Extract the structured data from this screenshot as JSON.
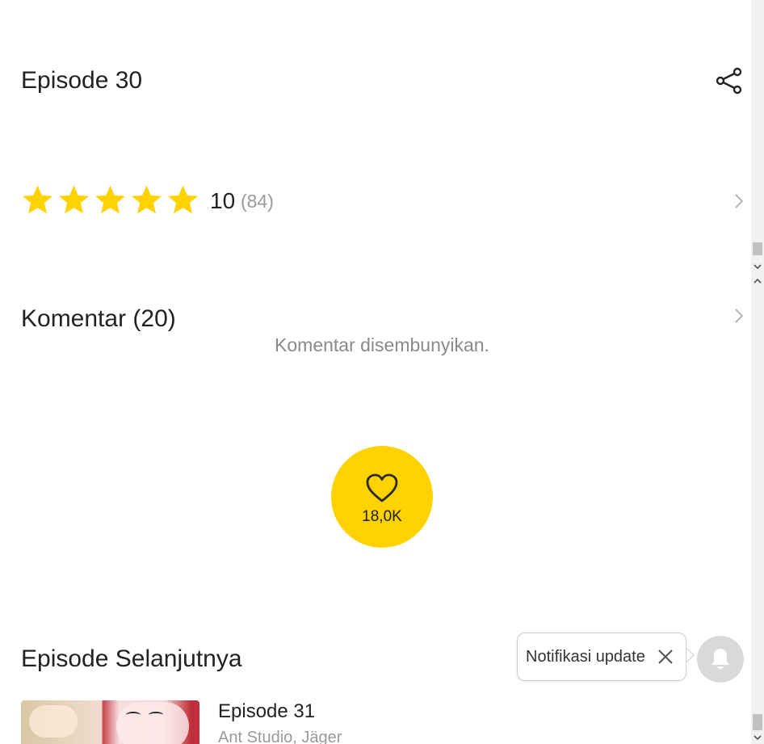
{
  "episode": {
    "title": "Episode 30"
  },
  "rating": {
    "score": "10",
    "count": "(84)",
    "stars": 5
  },
  "comments": {
    "title": "Komentar (20)",
    "hidden_text": "Komentar disembunyikan."
  },
  "like": {
    "count": "18,0K"
  },
  "next": {
    "title": "Episode Selanjutnya",
    "episode": "Episode 31",
    "author": "Ant Studio, Jäger"
  },
  "notification": {
    "text": "Notifikasi update"
  },
  "colors": {
    "accent": "#ffd200",
    "star": "#ffd200",
    "muted": "#9a9a9a",
    "bell_bg": "#d9d9d9"
  }
}
